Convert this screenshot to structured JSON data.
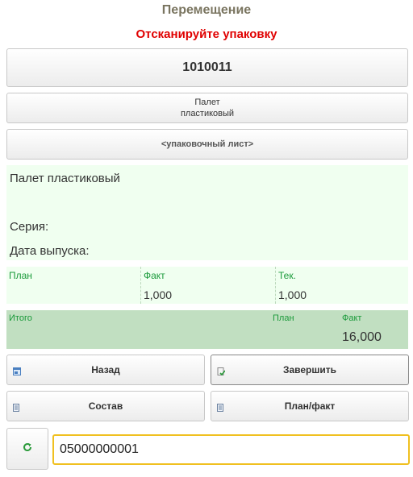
{
  "header": {
    "title": "Перемещение",
    "status": "Отсканируйте упаковку"
  },
  "package_code": "1010011",
  "pallet_button": {
    "line1": "Палет",
    "line2": "пластиковый"
  },
  "packing_list_button": "<упаковочный лист>",
  "item_info": {
    "name": "Палет пластиковый",
    "series_label": "Серия:",
    "date_label": "Дата выпуска:"
  },
  "plan_table": {
    "headers": [
      "План",
      "Факт",
      "Тек."
    ],
    "values": [
      "",
      "1,000",
      "1,000"
    ]
  },
  "totals": {
    "label": "Итого",
    "plan_label": "План",
    "fact_label": "Факт",
    "fact_value": "16,000"
  },
  "actions": {
    "back": "Назад",
    "finish": "Завершить",
    "contents": "Состав",
    "plan_fact": "План/факт"
  },
  "scan_input": {
    "value": "05000000001"
  },
  "icons": {
    "refresh": "refresh-icon",
    "back": "window-back-icon",
    "finish": "document-check-icon",
    "contents": "document-icon",
    "plan_fact": "document-icon"
  },
  "colors": {
    "title": "#7a7560",
    "status": "#e00000",
    "accent_green": "#1a9a3a",
    "panel_light": "#f0fff0",
    "panel_total": "#c1dfc1",
    "input_border": "#f0c020"
  }
}
